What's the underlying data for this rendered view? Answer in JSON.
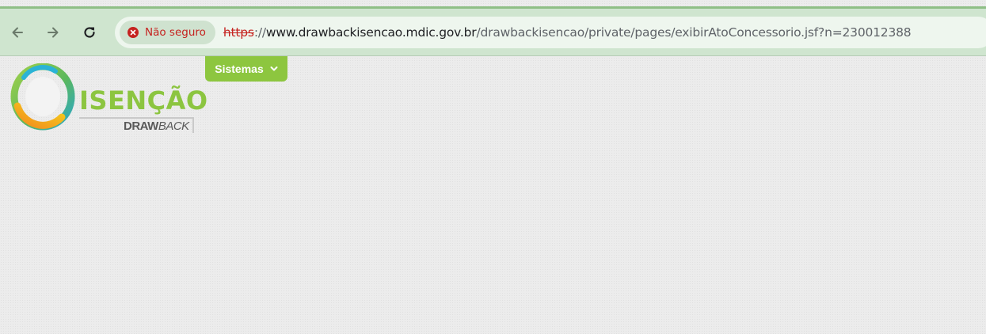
{
  "browser": {
    "security_label": "Não seguro",
    "url": {
      "scheme": "https",
      "separator": "://",
      "host": "www.drawbackisencao.mdic.gov.br",
      "path": "/drawbackisencao/private/pages/exibirAtoConcessorio.jsf?n=230012388"
    },
    "icons": {
      "back": "arrow-left-icon",
      "forward": "arrow-right-icon",
      "reload": "reload-icon",
      "security": "error-circle-icon"
    }
  },
  "page": {
    "menu": {
      "sistemas_label": "Sistemas",
      "caret_icon": "chevron-down-icon"
    },
    "logo": {
      "word": "ISENÇÃO",
      "sub_bold": "DRAW",
      "sub_light": "BACK"
    }
  },
  "colors": {
    "accent_green": "#8dc63f",
    "toolbar_bg": "#cfe5cf",
    "warning_red": "#c5221f",
    "page_bg": "#ececec"
  }
}
